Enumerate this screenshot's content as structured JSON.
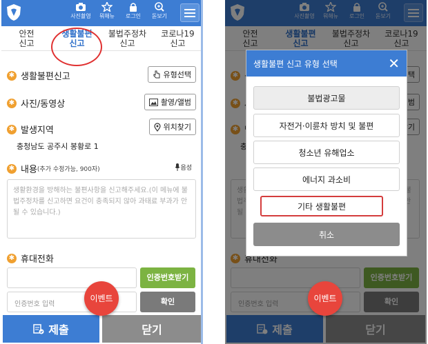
{
  "header": {
    "icons": [
      {
        "name": "camera-icon",
        "label": "사진촬영"
      },
      {
        "name": "star-icon",
        "label": "뭐해뉴"
      },
      {
        "name": "lock-icon",
        "label": "로그인"
      },
      {
        "name": "zoom-icon",
        "label": "돋보기"
      }
    ]
  },
  "tabs": [
    {
      "line1": "안전",
      "line2": "신고"
    },
    {
      "line1": "생활불편",
      "line2": "신고"
    },
    {
      "line1": "불법주정차",
      "line2": "신고"
    },
    {
      "line1": "코로나19",
      "line2": "신고"
    }
  ],
  "form": {
    "report_label": "생활불편신고",
    "type_button": "유형선택",
    "media_label": "사진/동영상",
    "media_button": "촬영/앨범",
    "region_label": "발생지역",
    "location_button": "위치찾기",
    "address": "충청남도 공주시 봉황로 1",
    "content_label": "내용",
    "content_hint": "(추가 수정가능, 900자)",
    "voice_label": "음성",
    "content_placeholder": "생활환경을 방해하는 불편사항을 신고해주세요.(이 메뉴에 불법주정차를 신고하면 요건이 충족되지 않아 과태료 부과가 안될 수 있습니다.)",
    "phone_label": "휴대전화",
    "verify_request_button": "인증번호받기",
    "verify_placeholder": "인증번호 입력",
    "confirm_button": "확인"
  },
  "event_badge": "이벤트",
  "footer": {
    "submit": "제출",
    "close": "닫기"
  },
  "modal": {
    "title": "생활불편 신고 유형 선택",
    "options": [
      "불법광고물",
      "자전거·이륜차 방치 및 불편",
      "청소년 유해업소",
      "에너지 과소비",
      "기타 생활불편"
    ],
    "cancel": "취소"
  },
  "colors": {
    "primary": "#3d7dd3",
    "accent_star": "#f0a030",
    "green_button": "#7cb342",
    "event_red": "#e8453c",
    "highlight_red": "#d43c3c"
  }
}
